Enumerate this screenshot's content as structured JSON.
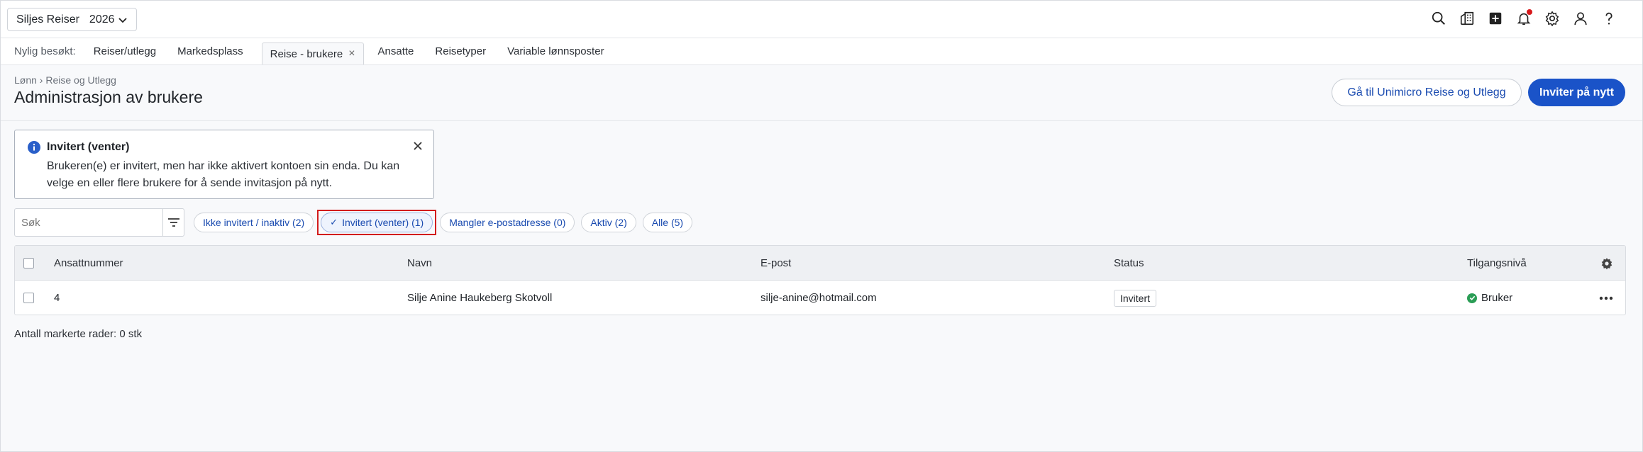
{
  "topbar": {
    "company": "Siljes Reiser",
    "year": "2026"
  },
  "recent": {
    "label": "Nylig besøkt:",
    "links": [
      "Reiser/utlegg",
      "Markedsplass"
    ],
    "active_tab": "Reise - brukere",
    "links_after": [
      "Ansatte",
      "Reisetyper",
      "Variable lønnsposter"
    ]
  },
  "header": {
    "breadcrumb": "Lønn › Reise og Utlegg",
    "title": "Administrasjon av brukere",
    "btn_goto": "Gå til Unimicro Reise og Utlegg",
    "btn_invite": "Inviter på nytt"
  },
  "info": {
    "title": "Invitert (venter)",
    "text": "Brukeren(e) er invitert, men har ikke aktivert kontoen sin enda. Du kan velge en eller flere brukere for å sende invitasjon på nytt."
  },
  "search": {
    "placeholder": "Søk"
  },
  "chips": {
    "not_invited": "Ikke invitert / inaktiv (2)",
    "invited": "Invitert (venter) (1)",
    "missing_email": "Mangler e-postadresse (0)",
    "active": "Aktiv (2)",
    "all": "Alle (5)"
  },
  "table": {
    "columns": {
      "employee_no": "Ansattnummer",
      "name": "Navn",
      "email": "E-post",
      "status": "Status",
      "access": "Tilgangsnivå"
    },
    "rows": [
      {
        "employee_no": "4",
        "name": "Silje Anine Haukeberg Skotvoll",
        "email": "silje-anine@hotmail.com",
        "status": "Invitert",
        "access": "Bruker"
      }
    ]
  },
  "footer": {
    "selected_count": "Antall markerte rader: 0 stk"
  },
  "colors": {
    "primary": "#1a53c8",
    "link": "#1a4bb0",
    "highlight": "#d21c1c",
    "success": "#2a9d55"
  }
}
